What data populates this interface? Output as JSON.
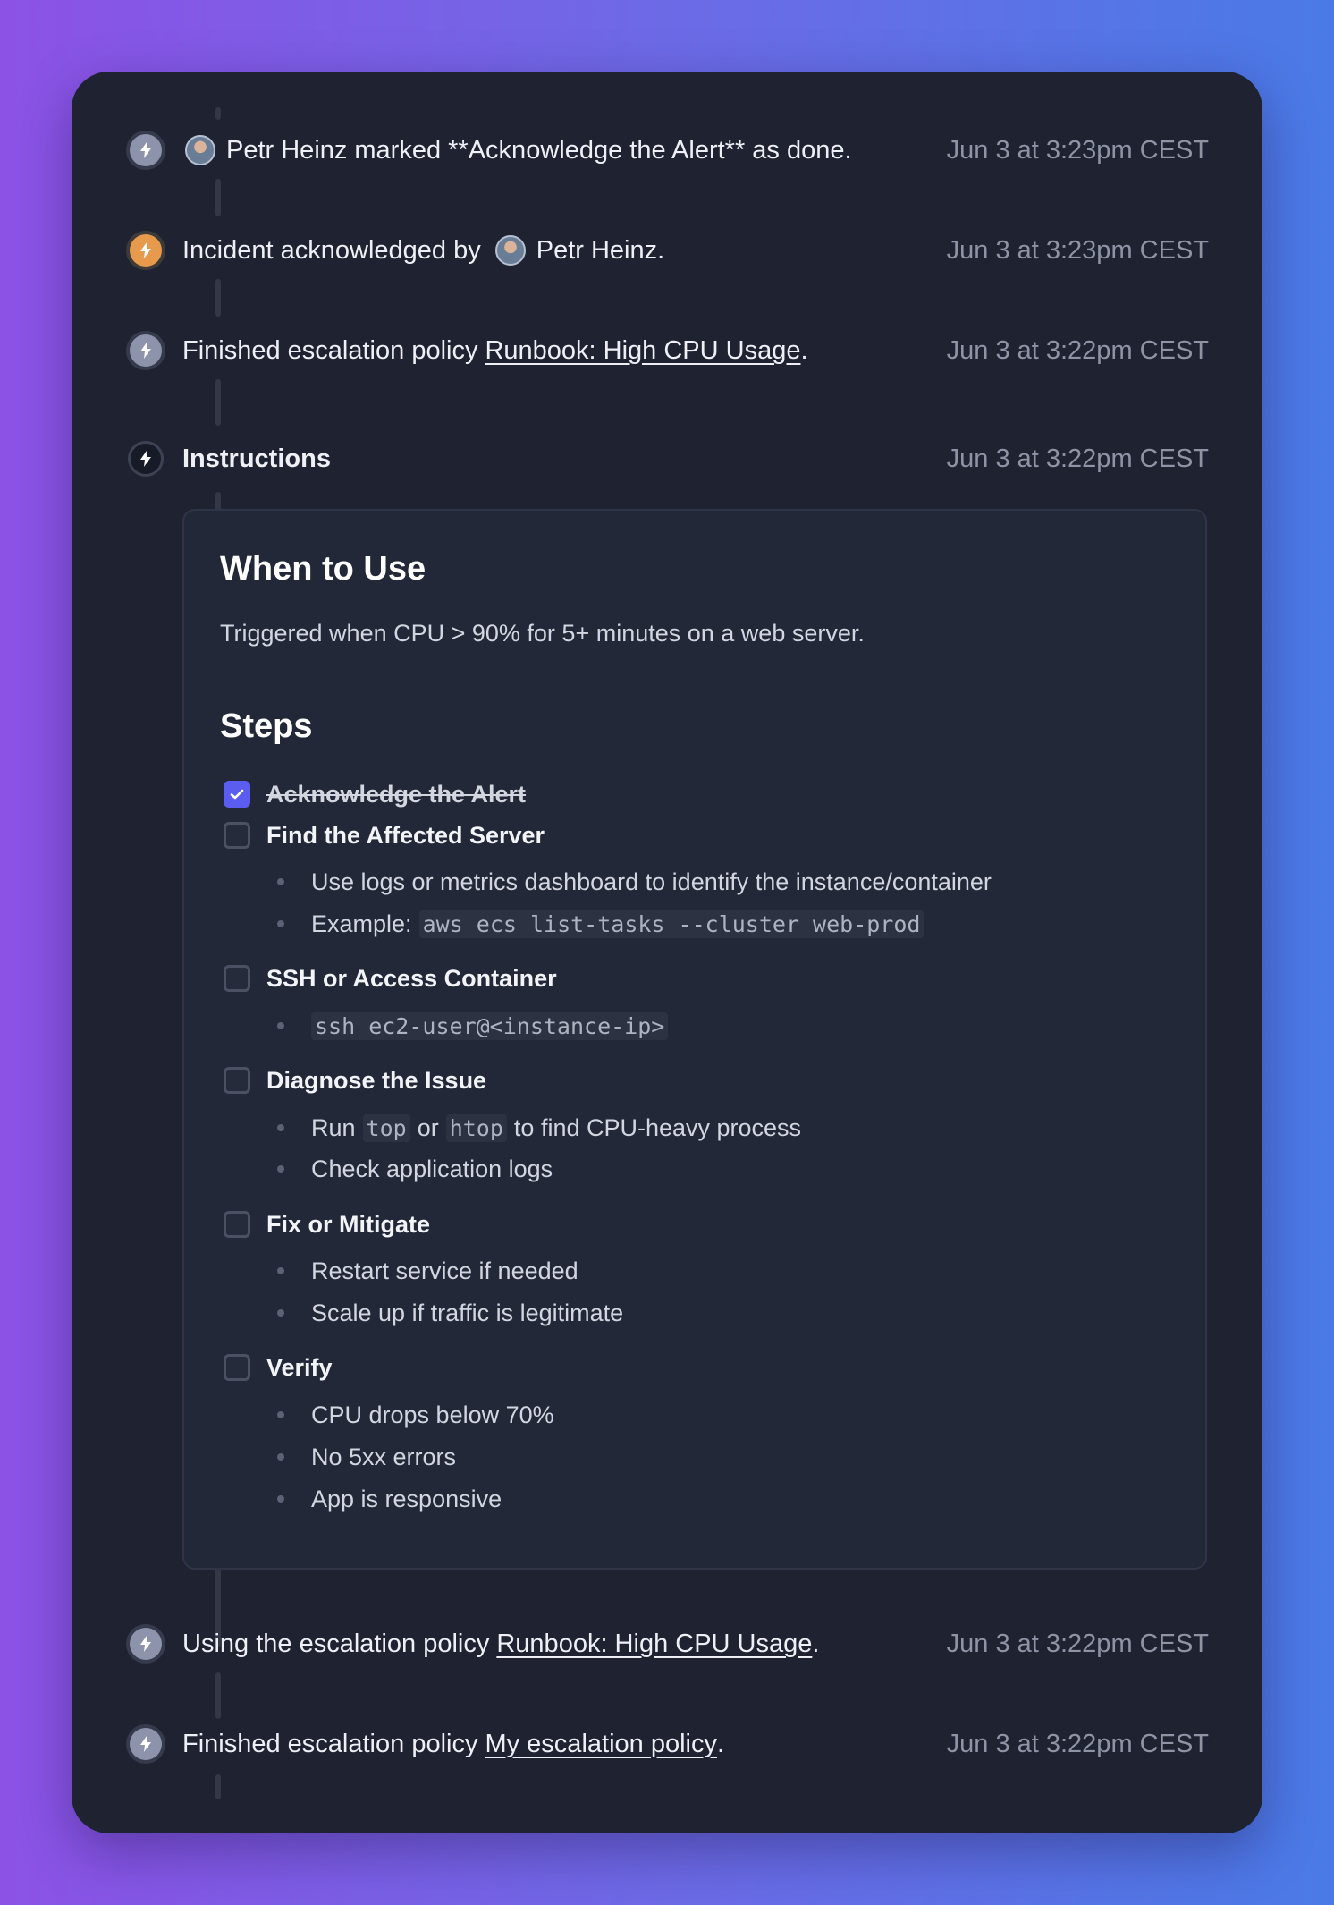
{
  "events": [
    {
      "id": "e1",
      "person": "Petr Heinz",
      "text": "marked **Acknowledge the Alert** as done.",
      "time": "Jun 3 at 3:23pm CEST"
    },
    {
      "id": "e2",
      "text": "Incident acknowledged by",
      "person": "Petr Heinz",
      "suffix": ".",
      "time": "Jun 3 at 3:23pm CEST"
    },
    {
      "id": "e3",
      "text": "Finished escalation policy",
      "link": "Runbook: High CPU Usage",
      "suffix": ".",
      "time": "Jun 3 at 3:22pm CEST"
    },
    {
      "id": "e4",
      "title": "Instructions",
      "time": "Jun 3 at 3:22pm CEST"
    },
    {
      "id": "e5",
      "text": "Using the escalation policy",
      "link": "Runbook: High CPU Usage",
      "suffix": ".",
      "time": "Jun 3 at 3:22pm CEST"
    },
    {
      "id": "e6",
      "text": "Finished escalation policy",
      "link": "My escalation policy",
      "suffix": ".",
      "time": "Jun 3 at 3:22pm CEST"
    }
  ],
  "instructions": {
    "when_heading": "When to Use",
    "when_text": "Triggered when CPU > 90% for 5+ minutes on a web server.",
    "steps_heading": "Steps",
    "steps": [
      {
        "label": "Acknowledge the Alert",
        "checked": true,
        "bullets": []
      },
      {
        "label": "Find the Affected Server",
        "checked": false,
        "bullets": [
          "Use logs or metrics dashboard to identify the instance/container"
        ],
        "example_prefix": "Example:",
        "example_code": "aws ecs list-tasks --cluster web-prod"
      },
      {
        "label": "SSH or Access Container",
        "checked": false,
        "code_bullet": "ssh ec2-user@<instance-ip>"
      },
      {
        "label": "Diagnose the Issue",
        "checked": false,
        "run_prefix": "Run",
        "run_code1": "top",
        "run_or": "or",
        "run_code2": "htop",
        "run_suffix": "to find CPU-heavy process",
        "bullets": [
          "Check application logs"
        ]
      },
      {
        "label": "Fix or Mitigate",
        "checked": false,
        "bullets": [
          "Restart service if needed",
          "Scale up if traffic is legitimate"
        ]
      },
      {
        "label": "Verify",
        "checked": false,
        "bullets": [
          "CPU drops below 70%",
          "No 5xx errors",
          "App is responsive"
        ]
      }
    ]
  },
  "colors": {
    "accent": "#5b5cf0",
    "orange_icon": "#e89a4c",
    "grey_icon": "#8d93aa",
    "card_bg": "#1f2230"
  },
  "icons": {
    "event": "lightning-bolt-icon",
    "checked": "checkmark-icon",
    "avatar": "user-avatar"
  }
}
